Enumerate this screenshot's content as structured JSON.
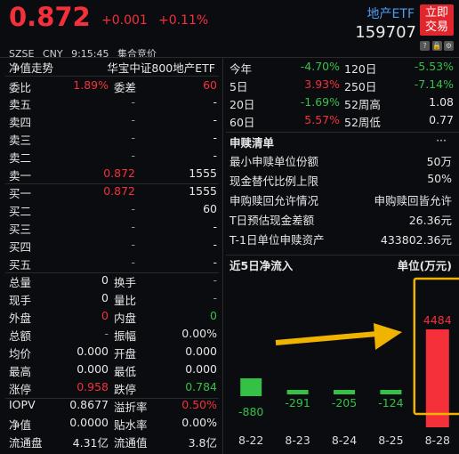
{
  "header": {
    "price": "0.872",
    "change": "+0.001",
    "change_pct": "+0.11%",
    "market": "SZSE",
    "currency": "CNY",
    "time": "9:15:45",
    "session": "集合竞价",
    "etf_name": "地产ETF",
    "etf_code": "159707",
    "trade_button": "立即交易"
  },
  "left": {
    "nav_title": "净值走势",
    "fund_name": "华宝中证800地产ETF",
    "weibi_label": "委比",
    "weibi_value": "1.89%",
    "weicha_label": "委差",
    "weicha_value": "60",
    "asks": [
      {
        "label": "卖五",
        "price": "-",
        "vol": "-"
      },
      {
        "label": "卖四",
        "price": "-",
        "vol": "-"
      },
      {
        "label": "卖三",
        "price": "-",
        "vol": "-"
      },
      {
        "label": "卖二",
        "price": "-",
        "vol": "-"
      },
      {
        "label": "卖一",
        "price": "0.872",
        "vol": "1555"
      }
    ],
    "bids": [
      {
        "label": "买一",
        "price": "0.872",
        "vol": "1555"
      },
      {
        "label": "买二",
        "price": "-",
        "vol": "60"
      },
      {
        "label": "买三",
        "price": "-",
        "vol": "-"
      },
      {
        "label": "买四",
        "price": "-",
        "vol": "-"
      },
      {
        "label": "买五",
        "price": "-",
        "vol": "-"
      }
    ],
    "stats": [
      {
        "l1": "总量",
        "v1": "0",
        "l2": "换手",
        "v2": "-"
      },
      {
        "l1": "现手",
        "v1": "0",
        "l2": "量比",
        "v2": "-"
      },
      {
        "l1": "外盘",
        "v1": "0",
        "l2": "内盘",
        "v2": "0"
      },
      {
        "l1": "总额",
        "v1": "-",
        "l2": "振幅",
        "v2": "0.00%"
      },
      {
        "l1": "均价",
        "v1": "0.000",
        "l2": "开盘",
        "v2": "0.000"
      },
      {
        "l1": "最高",
        "v1": "0.000",
        "l2": "最低",
        "v2": "0.000"
      },
      {
        "l1": "涨停",
        "v1": "0.958",
        "l2": "跌停",
        "v2": "0.784"
      },
      {
        "l1": "IOPV",
        "v1": "0.8677",
        "l2": "溢折率",
        "v2": "0.50%"
      },
      {
        "l1": "净值",
        "v1": "0.0000",
        "l2": "贴水率",
        "v2": "0.00%"
      },
      {
        "l1": "流通盘",
        "v1": "4.31亿",
        "l2": "流通值",
        "v2": "3.8亿"
      }
    ]
  },
  "right": {
    "perf": [
      {
        "l1": "今年",
        "v1": "-4.70%",
        "l2": "120日",
        "v2": "-5.53%"
      },
      {
        "l1": "5日",
        "v1": "3.93%",
        "l2": "250日",
        "v2": "-7.14%"
      },
      {
        "l1": "20日",
        "v1": "-1.69%",
        "l2": "52周高",
        "v2": "1.08"
      },
      {
        "l1": "60日",
        "v1": "5.57%",
        "l2": "52周低",
        "v2": "0.77"
      }
    ],
    "subscribe_title": "申赎清单",
    "more": "···",
    "subscribe": [
      {
        "label": "最小申赎单位份额",
        "value": "50万"
      },
      {
        "label": "现金替代比例上限",
        "value": "50%"
      },
      {
        "label": "申购赎回允许情况",
        "value": "申购赎回皆允许"
      },
      {
        "label": "T日预估现金差额",
        "value": "26.36元"
      },
      {
        "label": "T-1日单位申赎资产",
        "value": "433802.36元"
      }
    ],
    "flow_title": "近5日净流入",
    "flow_unit": "单位(万元)"
  },
  "chart_data": {
    "type": "bar",
    "title": "近5日净流入",
    "ylabel": "单位(万元)",
    "categories": [
      "8-22",
      "8-23",
      "8-24",
      "8-25",
      "8-28"
    ],
    "values": [
      -880,
      -291,
      -205,
      -124,
      4484
    ],
    "colors": {
      "positive": "#f5303a",
      "negative": "#35c046",
      "highlight": "#f0b400"
    }
  }
}
